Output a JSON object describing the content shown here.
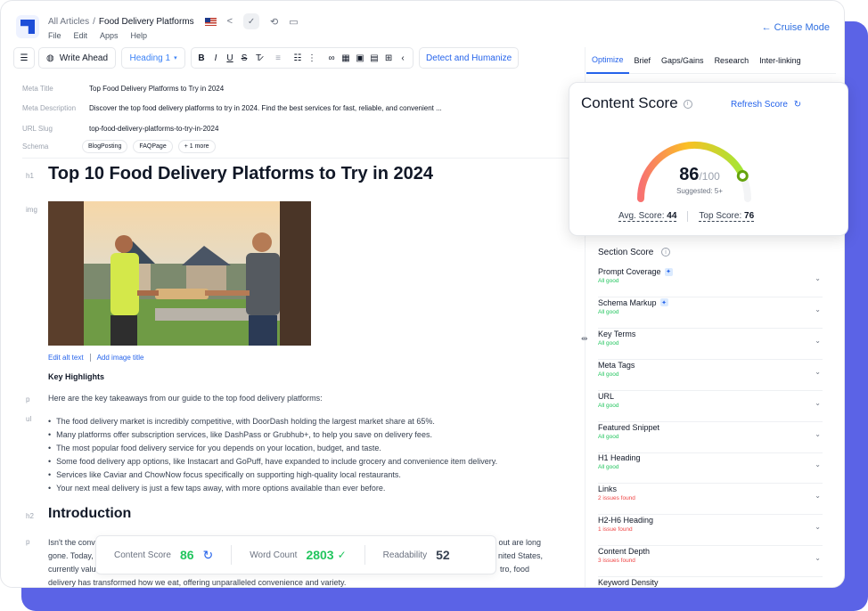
{
  "header": {
    "breadcrumb_root": "All Articles",
    "breadcrumb_sep": "/",
    "breadcrumb_current": "Food Delivery Platforms",
    "cruise_mode": "Cruise Mode"
  },
  "menu": [
    "File",
    "Edit",
    "Apps",
    "Help"
  ],
  "toolbar": {
    "write_ahead": "Write Ahead",
    "heading_select": "Heading 1",
    "detect": "Detect and Humanize"
  },
  "meta": {
    "title_label": "Meta Title",
    "title_value": "Top Food Delivery Platforms to Try in 2024",
    "desc_label": "Meta Description",
    "desc_value": "Discover the top food delivery platforms to try in 2024. Find the best services for fast, reliable, and convenient ...",
    "slug_label": "URL Slug",
    "slug_value": "top-food-delivery-platforms-to-try-in-2024",
    "schema_label": "Schema",
    "schema_chips": [
      "BlogPosting",
      "FAQPage",
      "+ 1 more"
    ]
  },
  "tags": {
    "h1": "h1",
    "img": "img",
    "p": "p",
    "ul": "ul",
    "h2": "h2"
  },
  "article": {
    "h1": "Top 10 Food Delivery Platforms to Try in 2024",
    "edit_alt": "Edit alt text",
    "add_image_title": "Add image title",
    "key_highlights": "Key Highlights",
    "intro_para": "Here are the key takeaways from our guide to the top food delivery platforms:",
    "bullets": [
      "The food delivery market is incredibly competitive, with DoorDash holding the largest market share at 65%.",
      "Many platforms offer subscription services, like DashPass or Grubhub+, to help you save on delivery fees.",
      "The most popular food delivery service for you depends on your location, budget, and taste.",
      "Some food delivery app options, like Instacart and GoPuff, have expanded to include grocery and convenience item delivery.",
      "Services like Caviar and ChowNow focus specifically on supporting high-quality local restaurants.",
      "Your next meal delivery is just a few taps away, with more options available than ever before."
    ],
    "h2": "Introduction",
    "para2_l1_start": "Isn't the conv",
    "para2_l1_end": "out are long",
    "para2_l2_start": "gone. Today,",
    "para2_l2_end": "nited States,",
    "para2_l3_start": "currently valu",
    "para2_l3_end": "tro, food",
    "para2_l4": "delivery has transformed how we eat, offering unparalleled convenience and variety."
  },
  "stats": {
    "content_score_label": "Content Score",
    "content_score_value": "86",
    "word_count_label": "Word Count",
    "word_count_value": "2803",
    "readability_label": "Readability",
    "readability_value": "52"
  },
  "tabs": [
    "Optimize",
    "Brief",
    "Gaps/Gains",
    "Research",
    "Inter-linking"
  ],
  "score_card": {
    "title": "Content Score",
    "refresh": "Refresh Score",
    "score": 86,
    "score_max": "/100",
    "suggested": "Suggested: 5+",
    "avg_label": "Avg. Score:",
    "avg_value": "44",
    "top_label": "Top Score:",
    "top_value": "76"
  },
  "section_score": {
    "title": "Section Score",
    "items": [
      {
        "name": "Prompt Coverage",
        "status": "All good",
        "badge": true
      },
      {
        "name": "Schema Markup",
        "status": "All good",
        "badge": true
      },
      {
        "name": "Key Terms",
        "status": "All good",
        "badge": false
      },
      {
        "name": "Meta Tags",
        "status": "All good",
        "badge": false
      },
      {
        "name": "URL",
        "status": "All good",
        "badge": false
      },
      {
        "name": "Featured Snippet",
        "status": "All good",
        "badge": false
      },
      {
        "name": "H1 Heading",
        "status": "All good",
        "badge": false
      },
      {
        "name": "Links",
        "status": "2 issues found",
        "badge": false
      },
      {
        "name": "H2-H6 Heading",
        "status": "1 issue found",
        "badge": false
      },
      {
        "name": "Content Depth",
        "status": "3 issues found",
        "badge": false
      },
      {
        "name": "Keyword Density",
        "status": "",
        "badge": false
      }
    ]
  },
  "colors": {
    "accent": "#2563eb",
    "good": "#22c55e",
    "issue": "#ef4444",
    "backdrop": "#5b63e6"
  }
}
